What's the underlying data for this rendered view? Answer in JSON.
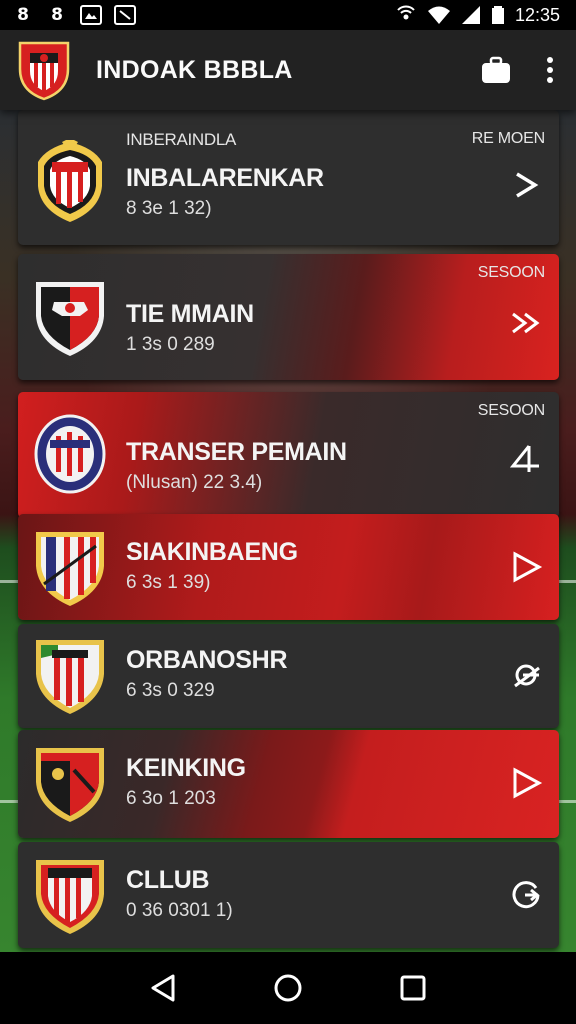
{
  "status_bar": {
    "icons": [
      "notification-icon-s",
      "notification-icon-8",
      "notification-icon-image",
      "notification-icon-photo"
    ],
    "glyphs": [
      "8",
      "8"
    ],
    "time": "12:35"
  },
  "app_bar": {
    "title": "INDOAK BBBLA",
    "logo_icon": "club-crest-icon",
    "actions": [
      "briefcase-icon",
      "more-vert-icon"
    ]
  },
  "list": [
    {
      "overline": "INBERAINDLA",
      "title": "INBALARENKAR",
      "subtitle": "8 3e 1 32)",
      "tag": "RE MOEN",
      "action_icon": "chevron-right-icon"
    },
    {
      "overline": "",
      "title": "TIE MMAIN",
      "subtitle": "1 3s 0 289",
      "tag": "SESOON",
      "action_icon": "double-chevron-icon"
    },
    {
      "overline": "",
      "title": "TRANSER PEMAIN",
      "subtitle": "(Nlusan) 22 3.4)",
      "tag": "SESOON",
      "action_icon": "four-icon"
    },
    {
      "overline": "",
      "title": "SIAKINBAENG",
      "subtitle": "6 3s 1 39)",
      "tag": "",
      "action_icon": "play-outline-icon"
    },
    {
      "overline": "",
      "title": "ORBANOSHR",
      "subtitle": "6 3s 0 329",
      "tag": "",
      "action_icon": "link-icon"
    },
    {
      "overline": "",
      "title": "KEINKING",
      "subtitle": "6 3o 1 203",
      "tag": "",
      "action_icon": "play-outline-icon"
    },
    {
      "overline": "",
      "title": "CLLUB",
      "subtitle": "0 36 0301 1)",
      "tag": "",
      "action_icon": "g-arrow-icon"
    }
  ],
  "nav_bar": {
    "buttons": [
      "back-icon",
      "home-icon",
      "recents-icon"
    ]
  },
  "colors": {
    "accent": "#D9221F",
    "card": "#2E2E2E",
    "appbar": "#222222"
  }
}
